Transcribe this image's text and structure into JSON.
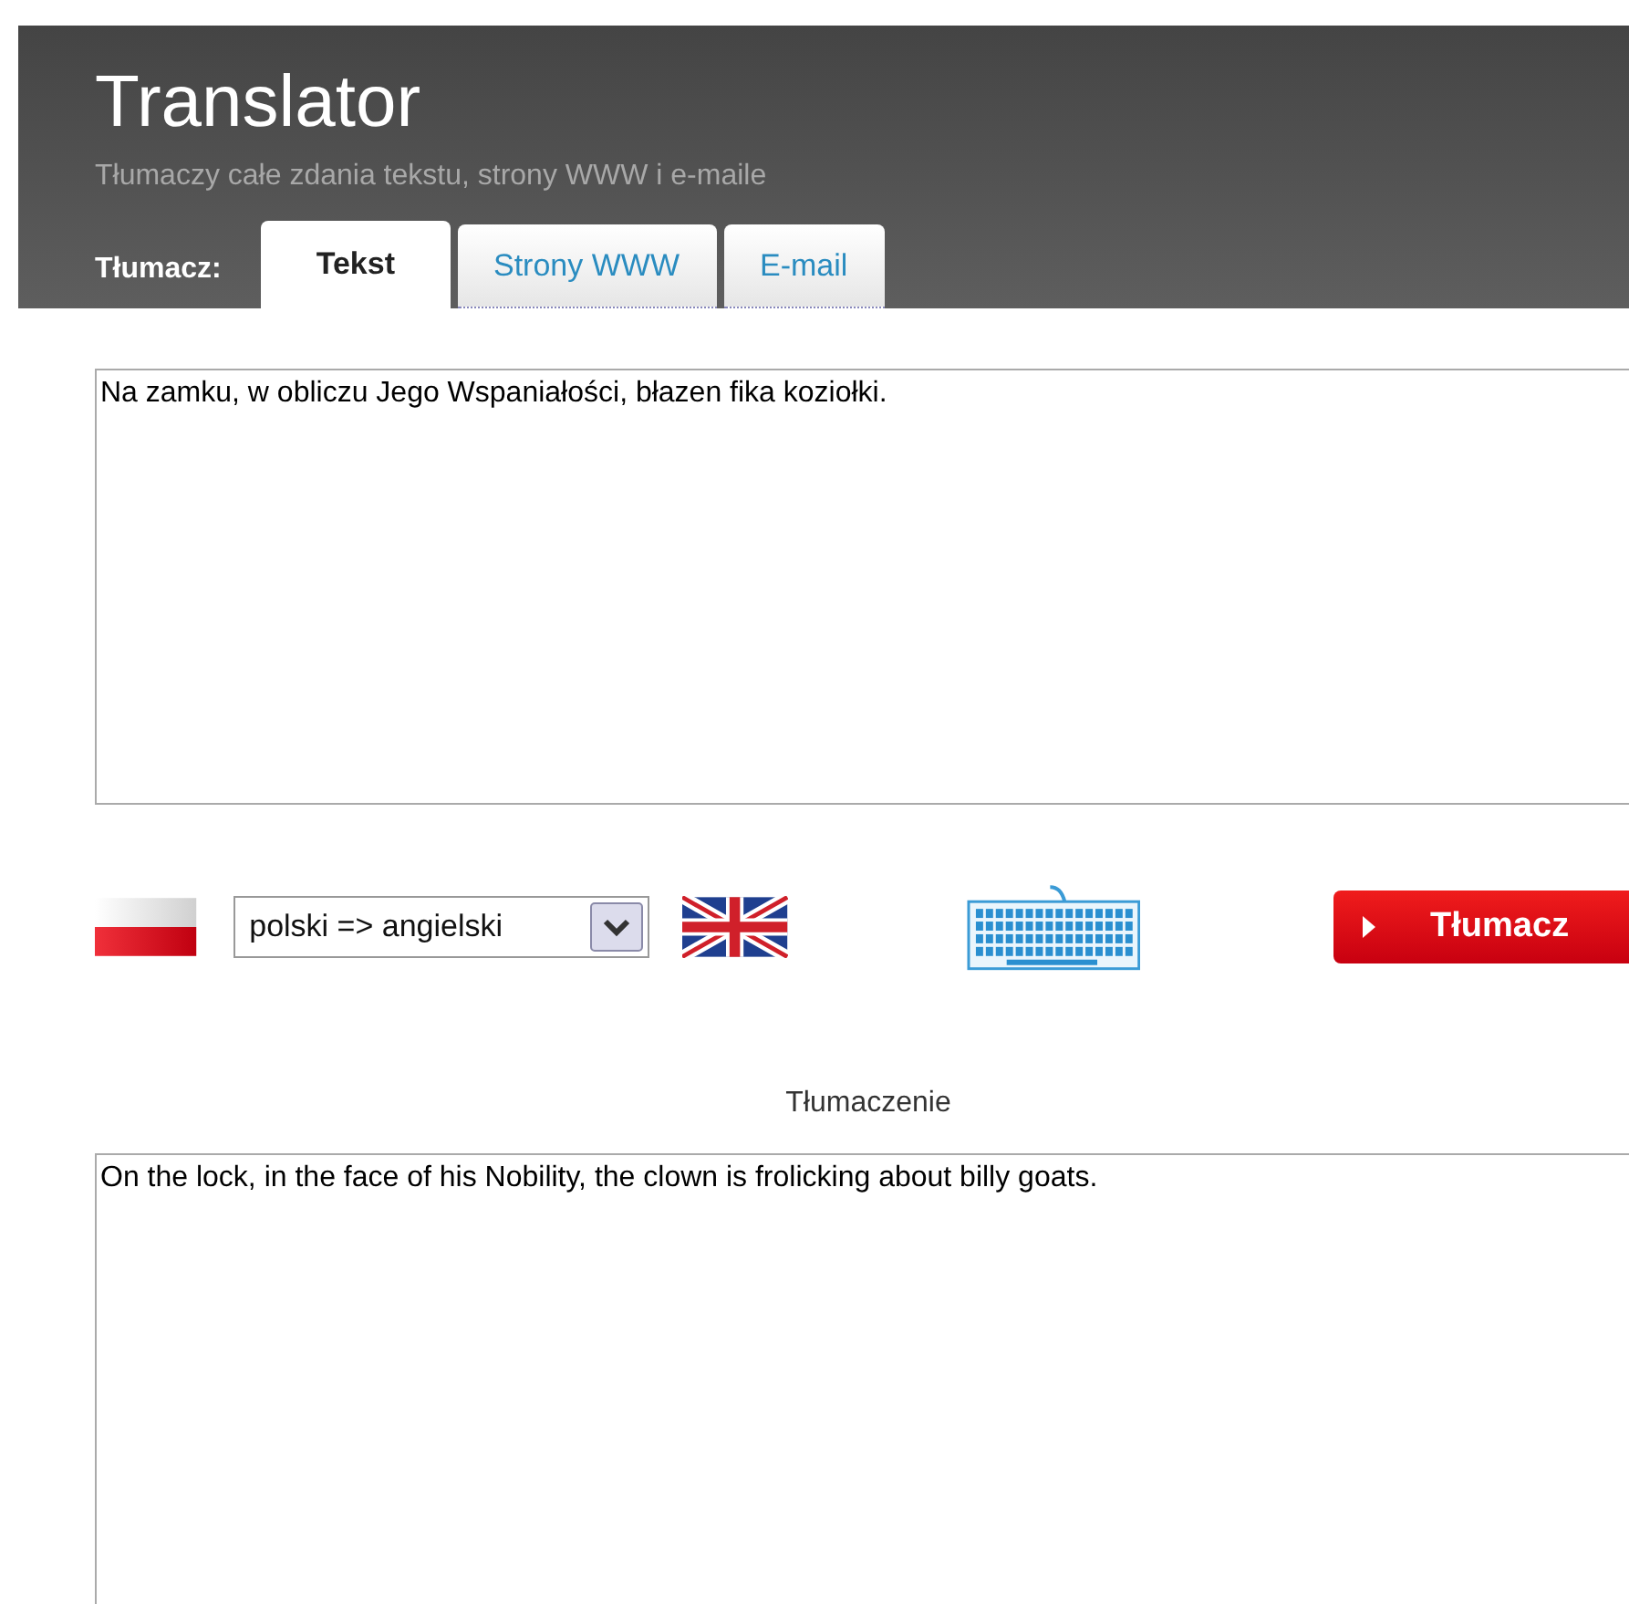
{
  "header": {
    "title": "Translator",
    "subtitle": "Tłumaczy całe zdania tekstu, strony WWW i e-maile",
    "tabs_label": "Tłumacz:"
  },
  "tabs": [
    {
      "label": "Tekst",
      "selected": true
    },
    {
      "label": "Strony WWW",
      "selected": false
    },
    {
      "label": "E-mail",
      "selected": false
    }
  ],
  "source": {
    "value": "Na zamku, w obliczu Jego Wspaniałości, błazen fika koziołki."
  },
  "language_select": {
    "value": "polski => angielski"
  },
  "translate_button": {
    "label": "Tłumacz"
  },
  "result": {
    "heading": "Tłumaczenie",
    "value": "On the lock, in the face of his Nobility, the clown is frolicking about billy goats."
  }
}
